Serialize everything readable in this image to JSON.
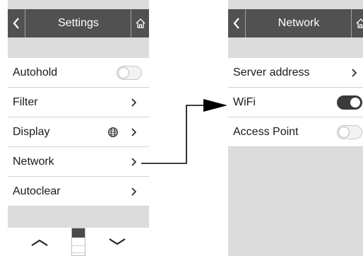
{
  "settings": {
    "title": "Settings",
    "items": [
      {
        "label": "Autohold",
        "control": "toggle",
        "on": false
      },
      {
        "label": "Filter",
        "control": "chevron"
      },
      {
        "label": "Display",
        "control": "chevron",
        "icon": "globe-icon"
      },
      {
        "label": "Network",
        "control": "chevron"
      },
      {
        "label": "Autoclear",
        "control": "chevron"
      }
    ]
  },
  "network": {
    "title": "Network",
    "items": [
      {
        "label": "Server address",
        "control": "chevron"
      },
      {
        "label": "WiFi",
        "control": "toggle",
        "on": true
      },
      {
        "label": "Access Point",
        "control": "toggle",
        "on": false
      }
    ]
  },
  "icons": [
    "back-icon",
    "home-icon",
    "chevron-right-icon",
    "globe-icon",
    "chevron-up-icon",
    "chevron-down-icon"
  ],
  "colors": {
    "header": "#515151",
    "screen_bg": "#dcdcdc",
    "toggle_on": "#3a3a3a"
  }
}
